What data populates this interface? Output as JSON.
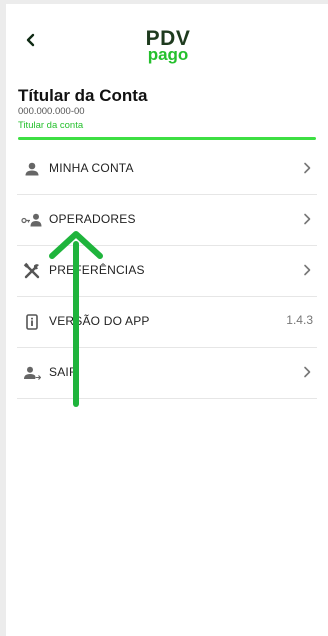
{
  "header": {
    "back_icon": "chevron-left-icon",
    "logo_line1": "PDV",
    "logo_line2": "pago"
  },
  "account": {
    "name": "Títular da Conta",
    "id": "000.000.000-00",
    "role": "Titular da conta"
  },
  "menu": {
    "items": [
      {
        "label": "MINHA CONTA",
        "icon": "person-icon",
        "trailing": "chevron-right-icon"
      },
      {
        "label": "OPERADORES",
        "icon": "operator-key-icon",
        "trailing": "chevron-right-icon"
      },
      {
        "label": "PREFERÊNCIAS",
        "icon": "tools-icon",
        "trailing": "chevron-right-icon"
      },
      {
        "label": "VERSÃO DO APP",
        "icon": "info-icon",
        "value": "1.4.3"
      },
      {
        "label": "SAIR",
        "icon": "logout-person-icon",
        "trailing": "chevron-right-icon"
      }
    ]
  },
  "colors": {
    "brand_dark": "#1e3a1e",
    "brand_green": "#25c02d",
    "accent_bar": "#3ddf43",
    "annotation_arrow": "#1fb43c"
  }
}
